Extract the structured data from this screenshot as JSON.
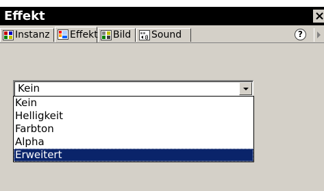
{
  "window": {
    "title": "Effekt",
    "close": "×"
  },
  "tabs": [
    {
      "label": "Instanz",
      "active": false,
      "icon": "instance-icon"
    },
    {
      "label": "Effekt",
      "active": true,
      "icon": "effect-icon"
    },
    {
      "label": "Bild",
      "active": false,
      "icon": "frame-icon"
    },
    {
      "label": "Sound",
      "active": false,
      "icon": "sound-icon"
    }
  ],
  "help_label": "?",
  "effect_select": {
    "value": "Kein",
    "options": [
      "Kein",
      "Helligkeit",
      "Farbton",
      "Alpha",
      "Erweitert"
    ],
    "highlighted_index": 4
  },
  "colors": {
    "highlight": "#0a246a",
    "panel": "#d4d0c8",
    "titlebar": "#000000"
  }
}
